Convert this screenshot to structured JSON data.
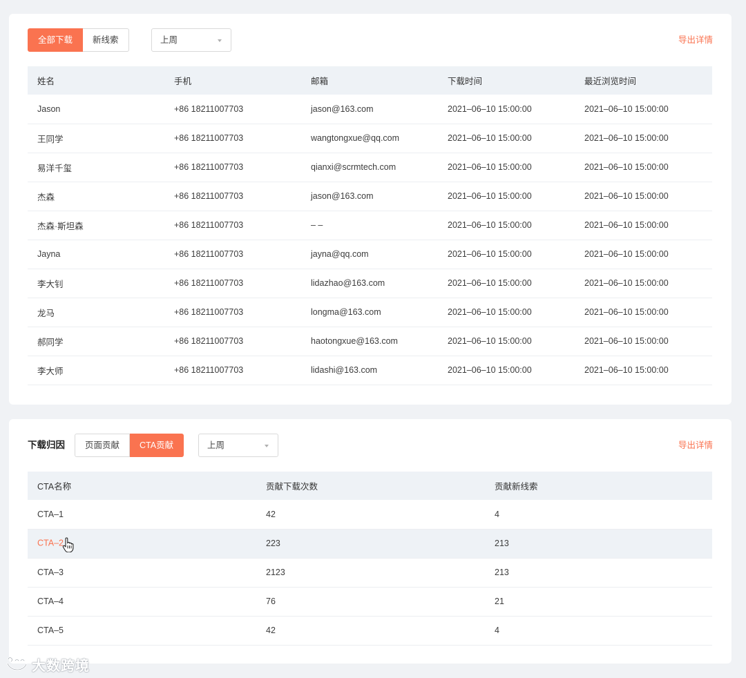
{
  "downloads": {
    "filter_tabs": [
      {
        "label": "全部下载",
        "active": true
      },
      {
        "label": "新线索",
        "active": false
      }
    ],
    "period_select": {
      "value": "上周"
    },
    "export_label": "导出详情",
    "columns": [
      "姓名",
      "手机",
      "邮箱",
      "下载时间",
      "最近浏览时间"
    ],
    "rows": [
      [
        "Jason",
        "+86 18211007703",
        "jason@163.com",
        "2021–06–10 15:00:00",
        "2021–06–10 15:00:00"
      ],
      [
        "王同学",
        "+86 18211007703",
        "wangtongxue@qq.com",
        "2021–06–10 15:00:00",
        "2021–06–10 15:00:00"
      ],
      [
        "易洋千玺",
        "+86 18211007703",
        "qianxi@scrmtech.com",
        "2021–06–10 15:00:00",
        "2021–06–10 15:00:00"
      ],
      [
        "杰森",
        "+86 18211007703",
        "jason@163.com",
        "2021–06–10 15:00:00",
        "2021–06–10 15:00:00"
      ],
      [
        "杰森·斯坦森",
        "+86 18211007703",
        "– –",
        "2021–06–10 15:00:00",
        "2021–06–10 15:00:00"
      ],
      [
        "Jayna",
        "+86 18211007703",
        "jayna@qq.com",
        "2021–06–10 15:00:00",
        "2021–06–10 15:00:00"
      ],
      [
        "李大钊",
        "+86 18211007703",
        "lidazhao@163.com",
        "2021–06–10 15:00:00",
        "2021–06–10 15:00:00"
      ],
      [
        "龙马",
        "+86 18211007703",
        "longma@163.com",
        "2021–06–10 15:00:00",
        "2021–06–10 15:00:00"
      ],
      [
        "郝同学",
        "+86 18211007703",
        "haotongxue@163.com",
        "2021–06–10 15:00:00",
        "2021–06–10 15:00:00"
      ],
      [
        "李大师",
        "+86 18211007703",
        "lidashi@163.com",
        "2021–06–10 15:00:00",
        "2021–06–10 15:00:00"
      ]
    ]
  },
  "attribution": {
    "title": "下载归因",
    "filter_tabs": [
      {
        "label": "页面贡献",
        "active": false
      },
      {
        "label": "CTA贡献",
        "active": true
      }
    ],
    "period_select": {
      "value": "上周"
    },
    "export_label": "导出详情",
    "columns": [
      "CTA名称",
      "贡献下载次数",
      "贡献新线索"
    ],
    "rows": [
      [
        "CTA–1",
        "42",
        "4"
      ],
      [
        "CTA–2",
        "223",
        "213"
      ],
      [
        "CTA–3",
        "2123",
        "213"
      ],
      [
        "CTA–4",
        "76",
        "21"
      ],
      [
        "CTA–5",
        "42",
        "4"
      ]
    ],
    "hovered_row": 1
  },
  "watermark": {
    "text": "大数跨境"
  },
  "colors": {
    "accent": "#fa7350",
    "header_bg": "#eef2f6",
    "page_bg": "#f0f2f5"
  }
}
